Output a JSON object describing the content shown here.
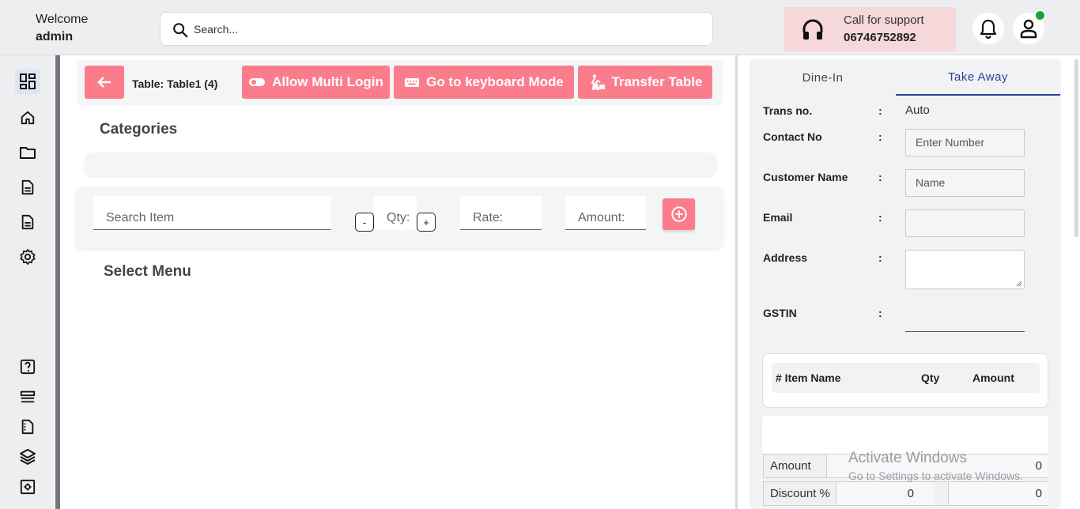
{
  "header": {
    "welcome_line": "Welcome",
    "username": "admin",
    "search_placeholder": "Search...",
    "support_label": "Call for support",
    "support_phone": "06746752892"
  },
  "sidebar": {
    "top_items": [
      "dashboard-icon",
      "home-icon",
      "folder-icon",
      "document-icon",
      "document-icon",
      "gear-icon"
    ],
    "bottom_items": [
      "help-icon",
      "list-icon",
      "file-icon",
      "layers-icon",
      "settings-box-icon"
    ]
  },
  "toolbar": {
    "table_label": "Table: Table1 (4)",
    "allow_multi_login": "Allow Multi Login",
    "keyboard_mode": "Go to keyboard Mode",
    "transfer_table": "Transfer Table"
  },
  "categories": {
    "title": "Categories"
  },
  "item_entry": {
    "search_item": "Search Item",
    "qty": "Qty:",
    "minus": "-",
    "plus": "+",
    "rate": "Rate:",
    "amount": "Amount:"
  },
  "menu": {
    "title": "Select Menu"
  },
  "order_panel": {
    "tabs": [
      "Dine-In",
      "Take Away"
    ],
    "active_tab": "Take Away",
    "fields": {
      "trans_no_label": "Trans no.",
      "trans_no_value": "Auto",
      "contact_label": "Contact No",
      "contact_placeholder": "Enter Number",
      "customer_label": "Customer Name",
      "customer_placeholder": "Name",
      "email_label": "Email",
      "address_label": "Address",
      "gstin_label": "GSTIN",
      "colon": ":"
    },
    "items_table": {
      "headers": [
        "# Item Name",
        "Qty",
        "Amount"
      ]
    },
    "summary": {
      "amount_label": "Amount",
      "amount_value": "0",
      "discount_label": "Discount %",
      "discount_pct": "0",
      "discount_value": "0"
    }
  },
  "watermark": {
    "line1": "Activate Windows",
    "line2": "Go to Settings to activate Windows."
  },
  "colors": {
    "accent": "#fb7d8c",
    "tab_active": "#2f3f99",
    "online": "#1aa33a"
  }
}
